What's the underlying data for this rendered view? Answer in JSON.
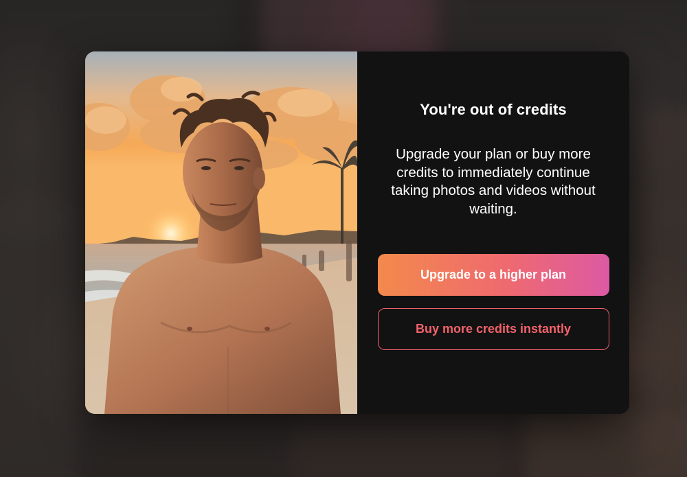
{
  "modal": {
    "title": "You're out of credits",
    "message": "Upgrade your plan or buy more credits to immediately continue taking photos and videos without waiting.",
    "primary_button_label": "Upgrade to a higher plan",
    "secondary_button_label": "Buy more credits instantly",
    "photo_alt": "Shirtless man standing on a beach at sunset"
  },
  "colors": {
    "modal_background": "#121213",
    "title_text": "#ffffff",
    "primary_gradient_start": "#f38a4c",
    "primary_gradient_end": "#dc5aa3",
    "secondary_accent": "#f0606a"
  }
}
